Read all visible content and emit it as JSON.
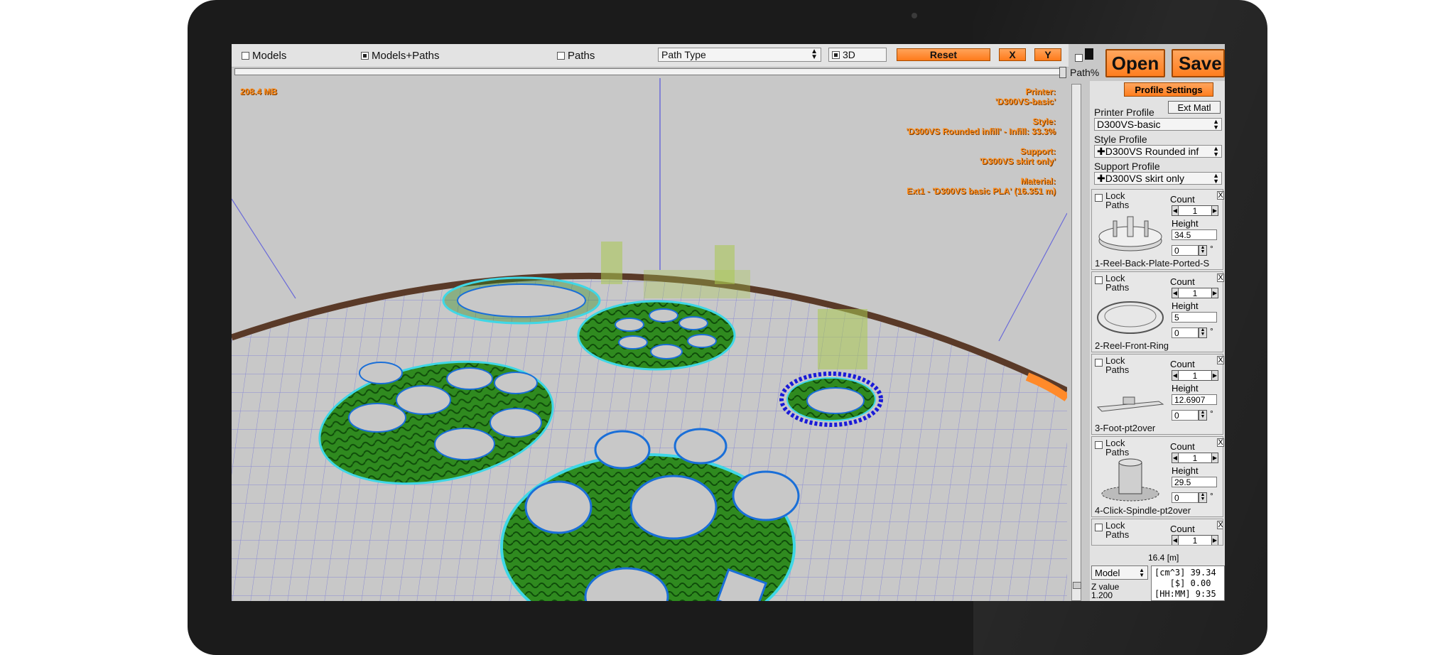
{
  "toolbar": {
    "models_label": "Models",
    "models_paths_label": "Models+Paths",
    "paths_label": "Paths",
    "path_type": "Path Type",
    "threed_label": "3D",
    "reset_label": "Reset",
    "x_label": "X",
    "y_label": "Y"
  },
  "viewport": {
    "memory": "208.4 MB",
    "printer_label": "Printer:",
    "printer_value": "'D300VS-basic'",
    "style_label": "Style:",
    "style_value": "'D300VS Rounded infill' - Infill: 33.3%",
    "support_label": "Support:",
    "support_value": "'D300VS skirt only'",
    "material_label": "Material:",
    "material_value": "Ext1 - 'D300VS basic PLA' (16.351 m)"
  },
  "panel": {
    "path_pct_label": "Path%",
    "open_label": "Open",
    "save_label": "Save",
    "profile_settings_label": "Profile Settings",
    "ext_matl_label": "Ext Matl",
    "printer_profile_label": "Printer Profile",
    "printer_profile_value": "D300VS-basic",
    "style_profile_label": "Style Profile",
    "style_profile_value": "✚D300VS Rounded inf",
    "support_profile_label": "Support Profile",
    "support_profile_value": "✚D300VS skirt only",
    "models": [
      {
        "lock": "Lock",
        "paths": "Paths",
        "count_label": "Count",
        "count": "1",
        "height_label": "Height",
        "height": "34.5",
        "rotation": "0",
        "name": "1-Reel-Back-Plate-Ported-S",
        "close": "X"
      },
      {
        "lock": "Lock",
        "paths": "Paths",
        "count_label": "Count",
        "count": "1",
        "height_label": "Height",
        "height": "5",
        "rotation": "0",
        "name": "2-Reel-Front-Ring",
        "close": "X"
      },
      {
        "lock": "Lock",
        "paths": "Paths",
        "count_label": "Count",
        "count": "1",
        "height_label": "Height",
        "height": "12.6907",
        "rotation": "0",
        "name": "3-Foot-pt2over",
        "close": "X"
      },
      {
        "lock": "Lock",
        "paths": "Paths",
        "count_label": "Count",
        "count": "1",
        "height_label": "Height",
        "height": "29.5",
        "rotation": "0",
        "name": "4-Click-Spindle-pt2over",
        "close": "X"
      },
      {
        "lock": "Lock",
        "paths": "Paths",
        "count_label": "Count",
        "count": "1",
        "height_label": "",
        "height": "",
        "rotation": "",
        "name": "",
        "close": "X"
      }
    ],
    "total_length": "16.4 [m]",
    "view_select": "Model",
    "z_label": "Z value",
    "z_value": "1.200",
    "stats_text": "[cm^3] 39.34\n   [$] 0.00\n[HH:MM] 9:35"
  },
  "colors": {
    "accent": "#ff8a2a",
    "infill": "#2f8a1f",
    "outline": "#3fd7e6"
  }
}
